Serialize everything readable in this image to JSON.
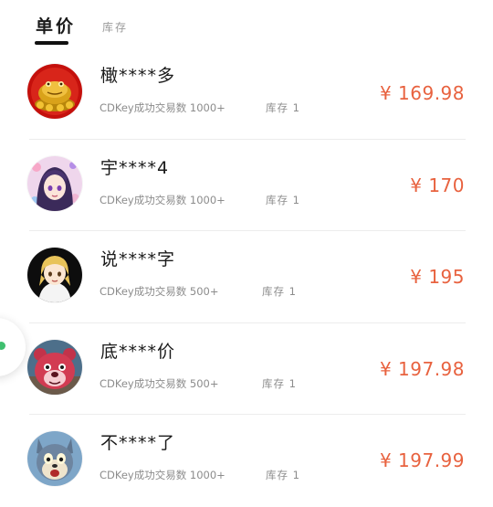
{
  "tabs": {
    "active_label": "单价",
    "inactive_label": "库存"
  },
  "currency_symbol": "¥",
  "colors": {
    "price": "#e8623f",
    "tab_indicator": "#111111",
    "side_handle_dot": "#3fbf6f"
  },
  "listings": [
    {
      "name": "橄****多",
      "trades": "CDKey成功交易数  1000+",
      "stock": "库存  1",
      "price": "¥ 169.98",
      "avatar_icon": "golden-toad-avatar"
    },
    {
      "name": "宇****4",
      "trades": "CDKey成功交易数  1000+",
      "stock": "库存  1",
      "price": "¥ 170",
      "avatar_icon": "anime-girl-avatar"
    },
    {
      "name": "说****字",
      "trades": "CDKey成功交易数  500+",
      "stock": "库存  1",
      "price": "¥ 195",
      "avatar_icon": "anime-character-avatar"
    },
    {
      "name": "底****价",
      "trades": "CDKey成功交易数  500+",
      "stock": "库存  1",
      "price": "¥ 197.98",
      "avatar_icon": "red-bear-avatar"
    },
    {
      "name": "不****了",
      "trades": "CDKey成功交易数  1000+",
      "stock": "库存  1",
      "price": "¥ 197.99",
      "avatar_icon": "cartoon-cat-avatar"
    }
  ]
}
